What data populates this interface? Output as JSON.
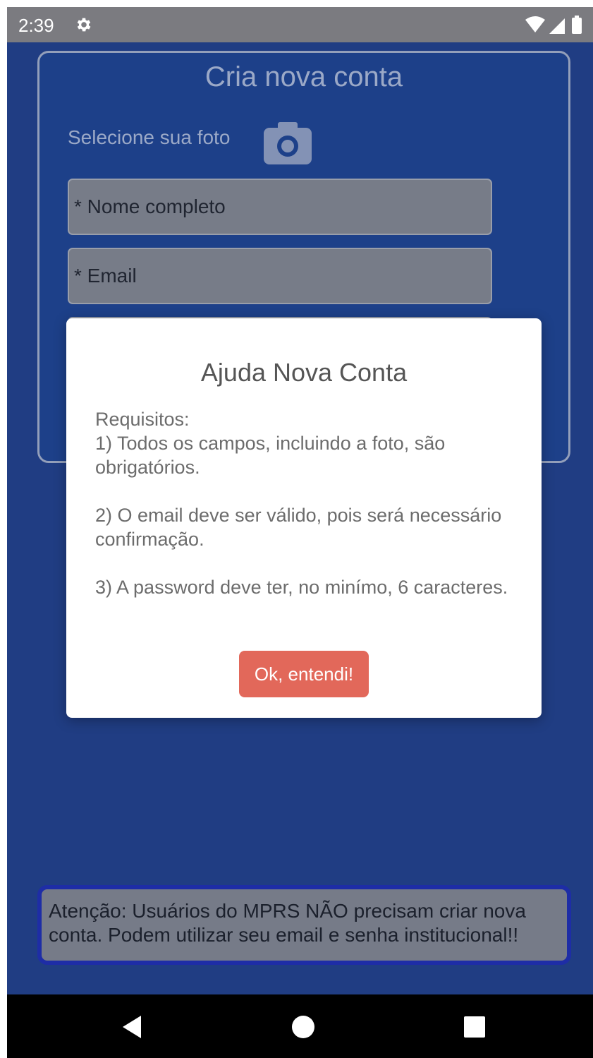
{
  "status_bar": {
    "time": "2:39",
    "icons": [
      "settings-gear-icon",
      "wifi-icon",
      "signal-icon",
      "battery-icon"
    ]
  },
  "form": {
    "title": "Cria nova conta",
    "photo_label": "Selecione sua foto",
    "camera_icon": "camera-icon",
    "fields": {
      "name_placeholder": "* Nome completo",
      "email_placeholder": "* Email"
    }
  },
  "warning": {
    "text": "Atenção: Usuários do MPRS NÃO precisam criar nova conta. Podem utilizar seu email e senha institucional!!",
    "border_color": "#1f2bb0"
  },
  "dialog": {
    "title": "Ajuda Nova Conta",
    "heading": "Requisitos:",
    "req1": "1) Todos os campos, incluindo a foto, são obrigatórios.",
    "req2": "2) O email deve ser válido, pois será necessário confirmação.",
    "req3": "3) A password deve ter, no minímo, 6 caracteres.",
    "ok_label": "Ok, entendi!",
    "ok_color": "#e2685a"
  },
  "nav_bar": {
    "icons": [
      "back-icon",
      "home-icon",
      "recents-icon"
    ]
  }
}
